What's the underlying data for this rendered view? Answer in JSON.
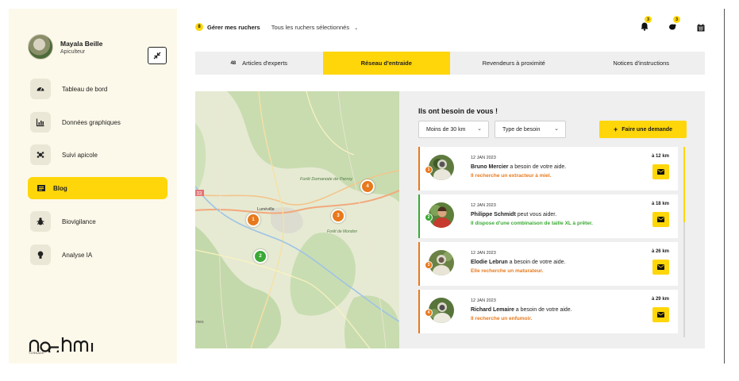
{
  "user": {
    "name": "Mayala Beille",
    "role": "Apiculteur"
  },
  "sidebar": {
    "items": [
      {
        "label": "Tableau de bord",
        "icon": "dashboard-icon"
      },
      {
        "label": "Données graphiques",
        "icon": "chart-icon"
      },
      {
        "label": "Suivi apicole",
        "icon": "hive-icon"
      },
      {
        "label": "Blog",
        "icon": "blog-icon",
        "active": true
      },
      {
        "label": "Biovigilance",
        "icon": "bug-icon"
      },
      {
        "label": "Analyse IA",
        "icon": "bulb-icon"
      }
    ],
    "logo": "noehmi",
    "logo_sub": "TORNADE"
  },
  "topbar": {
    "manage_count": "8",
    "manage_label": "Gérer mes ruchers",
    "rucher_select": "Tous les ruchers sélectionnés",
    "bell_count": "3",
    "bug_count": "3"
  },
  "tabs": [
    {
      "count": "48",
      "label": "Articles d'experts"
    },
    {
      "label": "Réseau d'entraide",
      "active": true
    },
    {
      "label": "Revendeurs à proximité"
    },
    {
      "label": "Notices d'instructions"
    }
  ],
  "map": {
    "labels": [
      "Forêt Domaniale de Parroy",
      "Lunéville",
      "Forêt de Mondon",
      "33",
      "mes"
    ],
    "markers": [
      {
        "num": "1",
        "color": "#e8791c"
      },
      {
        "num": "2",
        "color": "#3aa935"
      },
      {
        "num": "3",
        "color": "#e8791c"
      },
      {
        "num": "4",
        "color": "#e8791c"
      }
    ]
  },
  "panel": {
    "title": "Ils ont besoin de vous !",
    "distance_filter": "Moins de 30 km",
    "type_filter": "Type de besoin",
    "request_button": "Faire une demande"
  },
  "cards": [
    {
      "num": "1",
      "accent": "#e8791c",
      "date": "12 JAN 2023",
      "name": "Bruno Mercier",
      "verb": " a besoin de votre aide.",
      "need": "Il recherche un extracteur à miel.",
      "distance": "à 12 km"
    },
    {
      "num": "2",
      "accent": "#3aa935",
      "date": "12 JAN 2023",
      "name": "Philippe Schmidt",
      "verb": " peut vous aider.",
      "need": "Il dispose d'une combinaison de taille XL à prêter.",
      "distance": "à 18 km"
    },
    {
      "num": "3",
      "accent": "#e8791c",
      "date": "12 JAN 2023",
      "name": "Elodie Lebrun",
      "verb": " a besoin de votre aide.",
      "need": "Elle recherche un maturateur.",
      "distance": "à 26 km"
    },
    {
      "num": "4",
      "accent": "#e8791c",
      "date": "12 JAN 2023",
      "name": "Richard Lemaire",
      "verb": " a besoin de votre aide.",
      "need": "Il recherche un enfumoir.",
      "distance": "à 29 km"
    }
  ],
  "colors": {
    "accent": "#ffd60a",
    "orange": "#e8791c",
    "green": "#3aa935",
    "sidebar_bg": "#fdf9ea"
  }
}
